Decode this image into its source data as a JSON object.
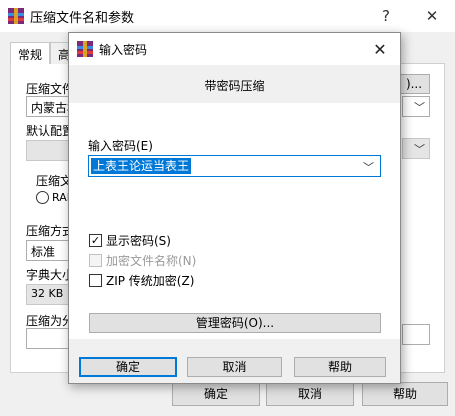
{
  "parent_window": {
    "title": "压缩文件名和参数",
    "help_glyph": "?",
    "close_glyph": "✕",
    "tabs": [
      {
        "label": "常规",
        "active": true
      },
      {
        "label": "高"
      }
    ],
    "labels": {
      "archive_name": "压缩文件",
      "default_profile": "默认配置",
      "archive_format": "压缩文",
      "rar_option": "RAR",
      "compression_method": "压缩方式",
      "dictionary_size": "字典大小",
      "split_volumes": "压缩为分"
    },
    "archive_name_value": "内蒙古档",
    "browse_label": ")...",
    "compression_method_value": "标准",
    "dictionary_size_value": "32 KB",
    "buttons": {
      "ok": "确定",
      "cancel": "取消",
      "help": "帮助"
    }
  },
  "dialog": {
    "title": "输入密码",
    "close_glyph": "✕",
    "heading": "带密码压缩",
    "password_label": "输入密码(E)",
    "password_value": "上表王论运当表王",
    "options": [
      {
        "label": "显示密码(S)",
        "checked": true,
        "enabled": true
      },
      {
        "label": "加密文件名称(N)",
        "checked": false,
        "enabled": false
      },
      {
        "label": "ZIP 传统加密(Z)",
        "checked": false,
        "enabled": true
      }
    ],
    "manage_label": "管理密码(O)...",
    "buttons": {
      "ok": "确定",
      "cancel": "取消",
      "help": "帮助"
    }
  },
  "colors": {
    "accent": "#0078d7",
    "window_bg": "#f0f0f0",
    "button_bg": "#e1e1e1"
  },
  "icons": {
    "app": "winrar-books-icon",
    "check": "✓",
    "chevron": "chevron-down-icon"
  }
}
